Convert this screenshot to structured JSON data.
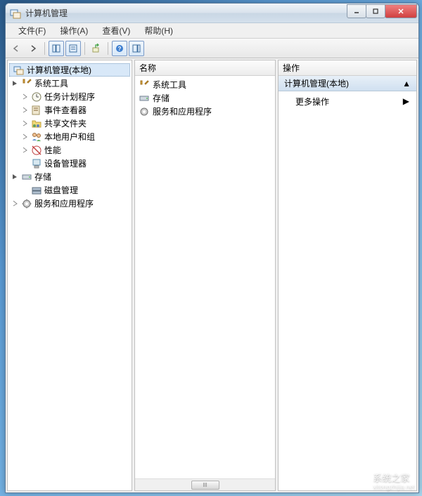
{
  "window": {
    "title": "计算机管理"
  },
  "menubar": {
    "file": "文件(F)",
    "action": "操作(A)",
    "view": "查看(V)",
    "help": "帮助(H)"
  },
  "tree": {
    "root": "计算机管理(本地)",
    "system_tools": "系统工具",
    "task_scheduler": "任务计划程序",
    "event_viewer": "事件查看器",
    "shared_folders": "共享文件夹",
    "local_users": "本地用户和组",
    "performance": "性能",
    "device_manager": "设备管理器",
    "storage": "存储",
    "disk_mgmt": "磁盘管理",
    "services_apps": "服务和应用程序"
  },
  "list": {
    "header_name": "名称",
    "item_system_tools": "系统工具",
    "item_storage": "存储",
    "item_services": "服务和应用程序"
  },
  "actions": {
    "header": "操作",
    "context": "计算机管理(本地)",
    "more_actions": "更多操作"
  },
  "watermark": {
    "text": "系统之家",
    "sub": "xitongzhijia.net"
  }
}
